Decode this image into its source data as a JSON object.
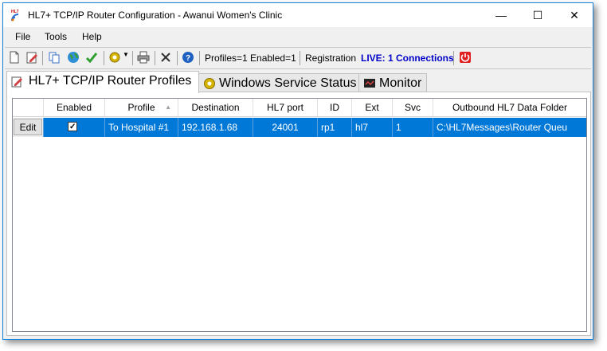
{
  "window": {
    "title": "HL7+ TCP/IP Router Configuration - Awanui Women's Clinic",
    "minimize": "—",
    "maximize": "☐",
    "close": "✕",
    "icon_text": "HL7"
  },
  "menu": [
    "File",
    "Tools",
    "Help"
  ],
  "toolbar": {
    "status": "Profiles=1 Enabled=1",
    "registration_label": "Registration",
    "live_status": "LIVE: 1 Connections",
    "live_color": "#0000c8"
  },
  "tabs": [
    {
      "label": "HL7+ TCP/IP Router Profiles",
      "active": true
    },
    {
      "label": "Windows Service Status",
      "active": false
    },
    {
      "label": "Monitor",
      "active": false
    }
  ],
  "grid": {
    "columns": [
      "",
      "Enabled",
      "Profile",
      "Destination",
      "HL7 port",
      "ID",
      "Ext",
      "Svc",
      "Outbound HL7 Data Folder"
    ],
    "sort_indicator": "▲",
    "rows": [
      {
        "edit": "Edit",
        "enabled": "✓",
        "profile": "To Hospital #1",
        "destination": "192.168.1.68",
        "port": "24001",
        "id": "rp1",
        "ext": "hl7",
        "svc": "1",
        "folder": "C:\\HL7Messages\\Router Queu"
      }
    ],
    "selected_color": "#0078d7"
  }
}
